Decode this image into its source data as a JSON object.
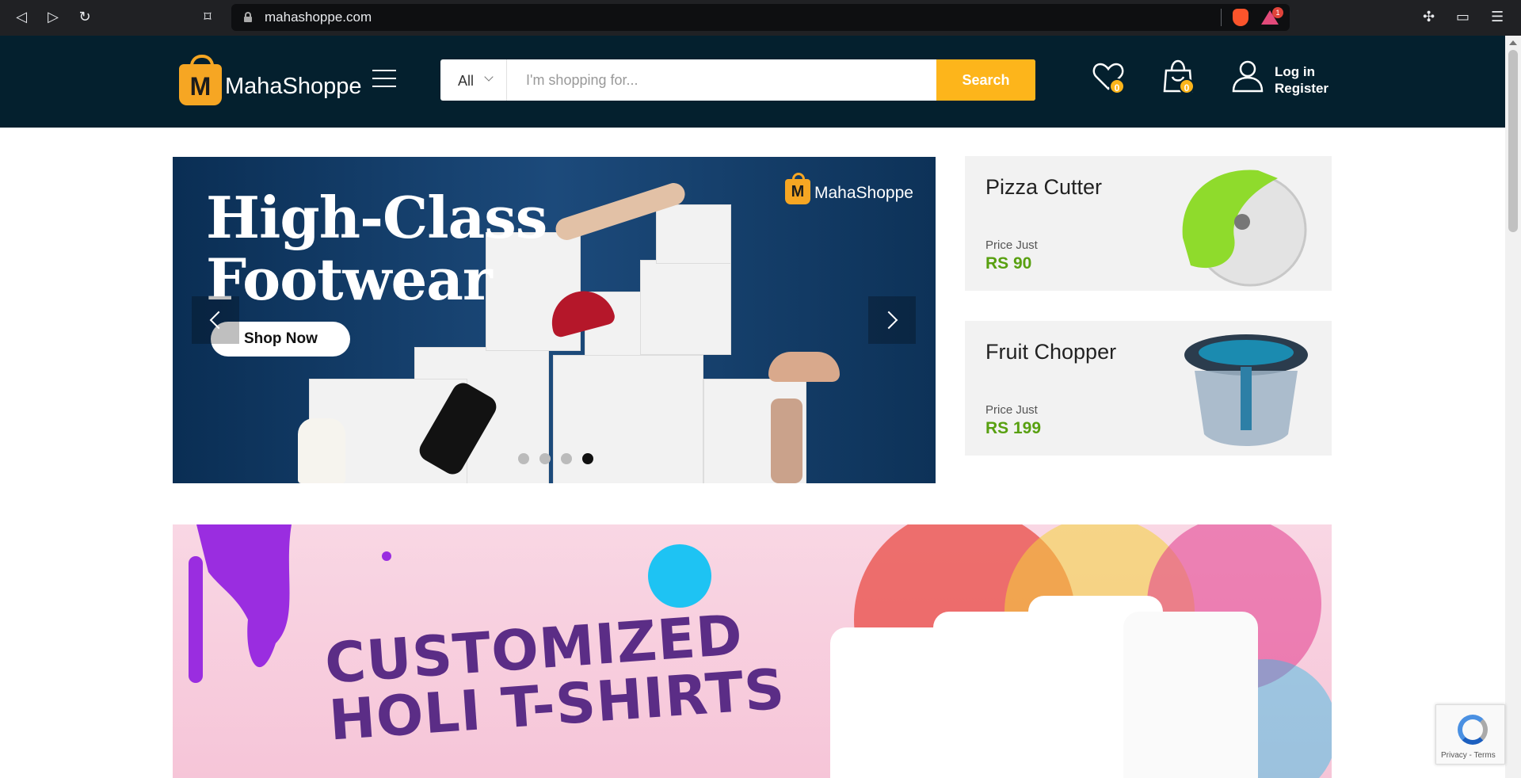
{
  "browser": {
    "url": "mahashoppe.com",
    "rewards_count": "1"
  },
  "header": {
    "logo_letter": "M",
    "logo_text": "MahaShoppe",
    "search": {
      "category": "All",
      "placeholder": "I'm shopping for...",
      "button_label": "Search"
    },
    "wishlist_count": "0",
    "cart_count": "0",
    "login_label": "Log in",
    "register_label": "Register"
  },
  "slider": {
    "title_line1": "High-Class",
    "title_line2": "Footwear",
    "cta_label": "Shop Now",
    "logo_letter": "M",
    "logo_text": "MahaShoppe",
    "slides_count": 4,
    "active_index": 3
  },
  "promos": [
    {
      "name": "Pizza Cutter",
      "price_label": "Price Just",
      "price": "RS 90"
    },
    {
      "name": "Fruit Chopper",
      "price_label": "Price Just",
      "price": "RS 199"
    }
  ],
  "banner": {
    "line1": "CUSTOMIZED",
    "line2": "HOLI T-SHIRTS"
  },
  "recaptcha": {
    "terms": "Privacy - Terms"
  },
  "colors": {
    "header_bg": "#04202e",
    "accent": "#fdb51b",
    "price_green": "#58a010",
    "banner_purple": "#5b2d86"
  }
}
